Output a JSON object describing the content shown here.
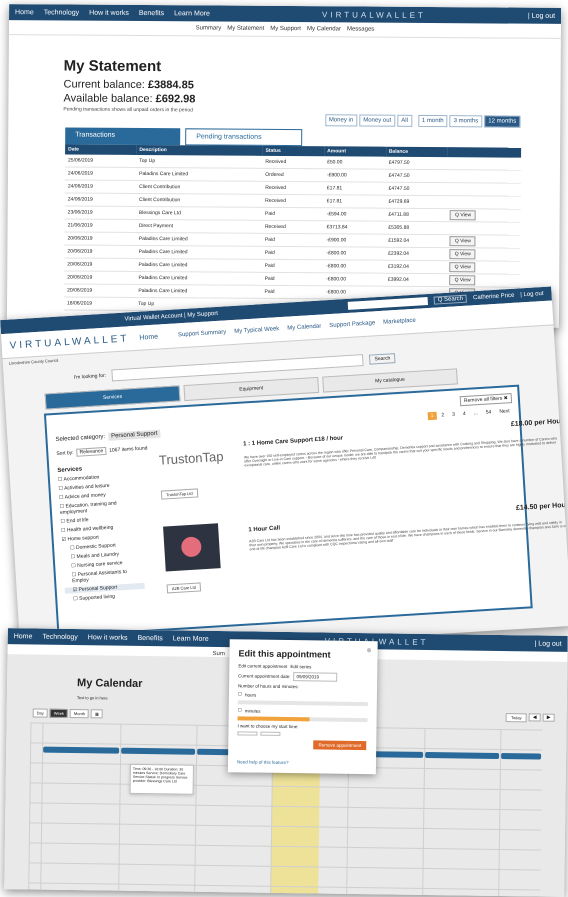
{
  "statement": {
    "nav": [
      "Home",
      "Technology",
      "How it works",
      "Benefits",
      "Learn More"
    ],
    "brand": "VIRTUALWALLET",
    "logout": "| Log out",
    "subnav": [
      "Summary",
      "My Statement",
      "My Support",
      "My Calendar",
      "Messages"
    ],
    "title": "My Statement",
    "current_balance_label": "Current balance:",
    "current_balance": "£3884.85",
    "available_balance_label": "Available balance:",
    "available_balance": "£692.98",
    "pending_note": "Pending transactions shows all unpaid orders in the period",
    "filters_a": [
      "Money in",
      "Money out",
      "All"
    ],
    "filters_b": [
      "1 month",
      "3 months",
      "12 months"
    ],
    "tabs": [
      "Transactions",
      "Pending transactions"
    ],
    "columns": [
      "Date",
      "Description",
      "Status",
      "Amount",
      "Balance"
    ],
    "view_label": "Q View",
    "rows": [
      {
        "date": "25/06/2019",
        "desc": "Top Up",
        "status": "Received",
        "amount": "£50.00",
        "balance": "£4797.50",
        "view": false
      },
      {
        "date": "24/06/2019",
        "desc": "Paladins Care Limited",
        "status": "Ordered",
        "amount": "-£900.00",
        "balance": "£4747.50",
        "view": false
      },
      {
        "date": "24/06/2019",
        "desc": "Client Contribution",
        "status": "Received",
        "amount": "£17.81",
        "balance": "£4747.50",
        "view": false
      },
      {
        "date": "24/06/2019",
        "desc": "Client Contribution",
        "status": "Received",
        "amount": "£17.81",
        "balance": "£4729.69",
        "view": false
      },
      {
        "date": "23/06/2019",
        "desc": "Blessings Care Ltd",
        "status": "Paid",
        "amount": "-£594.00",
        "balance": "£4711.88",
        "view": true
      },
      {
        "date": "21/06/2019",
        "desc": "Direct Payment",
        "status": "Received",
        "amount": "£3713.84",
        "balance": "£5305.88",
        "view": false
      },
      {
        "date": "20/06/2019",
        "desc": "Paladins Care Limited",
        "status": "Paid",
        "amount": "-£900.00",
        "balance": "£1592.04",
        "view": true
      },
      {
        "date": "20/06/2019",
        "desc": "Paladins Care Limited",
        "status": "Paid",
        "amount": "-£800.00",
        "balance": "£2392.04",
        "view": true
      },
      {
        "date": "20/06/2019",
        "desc": "Paladins Care Limited",
        "status": "Paid",
        "amount": "-£800.00",
        "balance": "£3192.04",
        "view": true
      },
      {
        "date": "20/06/2019",
        "desc": "Paladins Care Limited",
        "status": "Paid",
        "amount": "-£800.00",
        "balance": "£3992.04",
        "view": true
      },
      {
        "date": "20/06/2019",
        "desc": "Paladins Care Limited",
        "status": "Paid",
        "amount": "-£800.00",
        "balance": "",
        "view": true
      },
      {
        "date": "18/06/2019",
        "desc": "Top Up",
        "status": "",
        "amount": "",
        "balance": "",
        "view": false
      }
    ]
  },
  "support": {
    "top_title": "Virtual Wallet Account | My Support",
    "search_btn": "Q Search",
    "user": "Catherine Price",
    "logout": "| Log out",
    "brand": "VIRTUALWALLET",
    "home": "Home",
    "links": [
      "Support Summary",
      "My Typical Week",
      "My Calendar",
      "Support Package",
      "Marketplace"
    ],
    "council": "Lincolnshire County Council",
    "search_btn2": "Search",
    "looking_for": "I'm looking for:",
    "categories": [
      "Services",
      "Equipment",
      "My catalogue"
    ],
    "remove_filters": "Remove all filters",
    "pager": [
      "1",
      "2",
      "3",
      "4",
      "...",
      "54",
      "Next"
    ],
    "selected_category_label": "Selected category:",
    "selected_category": "Personal Support",
    "sort_by": "Sort by:",
    "sort_value": "Relevance",
    "found": "1067 items found",
    "services_heading": "Services",
    "services": [
      "Accommodation",
      "Activities and leisure",
      "Advice and money",
      "Education, training and employment",
      "End of life",
      "Health and wellbeing",
      "Home support"
    ],
    "services_sub": [
      "Domestic Support",
      "Meals and Laundry",
      "Nursing care service",
      "Personal Assistants to Employ",
      "Personal Support",
      "Supported living"
    ],
    "results": [
      {
        "title": "1 : 1 Home Care Support £18 / hour",
        "price": "£18.00",
        "per": "per Hour",
        "brand": "TrustonTap",
        "btn": "TrustonTap Ltd",
        "desc": "We have over 150 self-employed carers across the region who offer Personal Care, Companionship, Dementia support and assistance with Cooking and Shopping. We also have a number of Carers who offer Overnight or Live-in Care support. - Because of our unique model, we are able to handpick the carers that suit your specific needs and preferences to ensure that they are highly motivated to deliver exceptional care, unlike carers who work for some agencies - where they receive L40"
      },
      {
        "title": "1 Hour Call",
        "price": "£14.50",
        "per": "per Hour",
        "brand": "A2B Care Ltd",
        "btn": "A2B Care Ltd",
        "desc": "A2B Care Ltd has been established since 2004, and since this time has provided quality and affordable care for individuals in their own homes which has enabled them to continue living well and safely in their own property. We specialise in the care of dementia sufferers, and the care of those in end of life. We have champions in each of these fields. Service in our Barnsley dementia champion and Jane is our end of life champion A2B Care Ltd is compliant with CQC inspections/ rating and all own staff"
      }
    ]
  },
  "calendar": {
    "nav": [
      "Home",
      "Technology",
      "How it works",
      "Benefits",
      "Learn More"
    ],
    "brand": "VIRTUALWALLET",
    "logout": "| Log out",
    "subnav_left": "Sum",
    "subnav_right": "ges",
    "title": "My Calendar",
    "hint": "Text to go in here",
    "views": [
      "Day",
      "Week",
      "Month"
    ],
    "today": "Today",
    "tooltip": "Time: 09:30 - 10:00 Duration: 30 minutes Service: Domiciliary Care Service Status: In progress Service provider: Blessings Care Ltd",
    "modal": {
      "title": "Edit this appointment",
      "close": "⊗",
      "edit_current": "Edit current appointment",
      "edit_series": "Edit series",
      "date_label": "Current appointment date:",
      "date_value": "09/09/2019",
      "hours_heading": "Number of hours and minutes:",
      "hours": "hours",
      "minutes": "minutes",
      "start_question": "I want to choose my start time:",
      "remove": "Remove appointment",
      "help": "Need help of this feature?",
      "progress": 0.55
    }
  }
}
